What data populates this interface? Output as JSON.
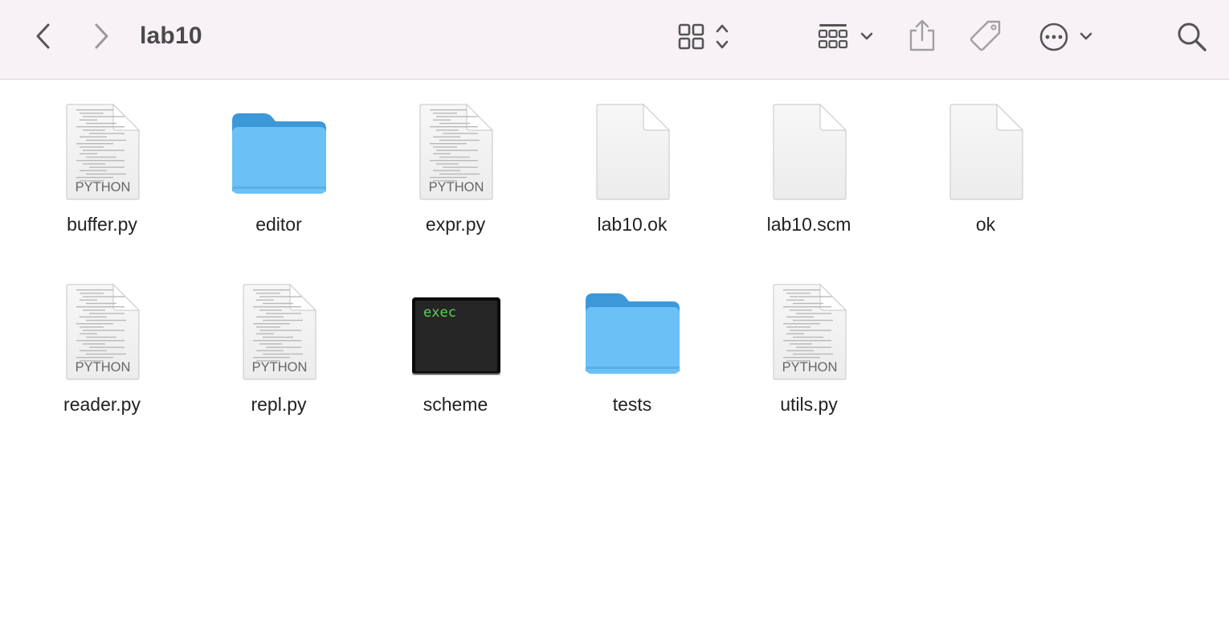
{
  "window": {
    "title": "lab10"
  },
  "toolbar": {
    "back_icon": "chevron-left-icon",
    "forward_icon": "chevron-right-icon",
    "view_icon": "grid-view-icon",
    "group_icon": "group-icon",
    "share_icon": "share-icon",
    "tag_icon": "tag-icon",
    "more_icon": "ellipsis-icon",
    "search_icon": "search-icon"
  },
  "colors": {
    "toolbar_bg": "#f8f2f6",
    "folder_blue": "#6ac1f5",
    "folder_tab": "#3d98d8",
    "terminal_green": "#5ad34f"
  },
  "files": [
    {
      "name": "buffer.py",
      "kind": "python",
      "badge": "PYTHON"
    },
    {
      "name": "editor",
      "kind": "folder"
    },
    {
      "name": "expr.py",
      "kind": "python",
      "badge": "PYTHON"
    },
    {
      "name": "lab10.ok",
      "kind": "blank"
    },
    {
      "name": "lab10.scm",
      "kind": "blank"
    },
    {
      "name": "ok",
      "kind": "blank"
    },
    {
      "name": "reader.py",
      "kind": "python",
      "badge": "PYTHON"
    },
    {
      "name": "repl.py",
      "kind": "python",
      "badge": "PYTHON"
    },
    {
      "name": "scheme",
      "kind": "exec",
      "badge": "exec"
    },
    {
      "name": "tests",
      "kind": "folder"
    },
    {
      "name": "utils.py",
      "kind": "python",
      "badge": "PYTHON"
    }
  ]
}
